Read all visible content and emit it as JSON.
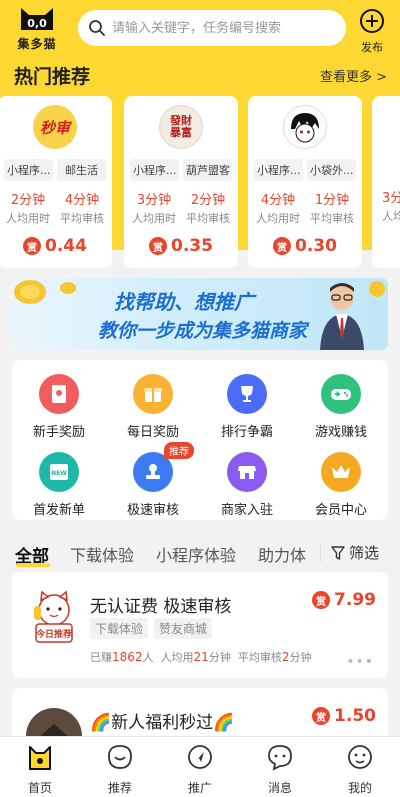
{
  "header": {
    "logo_text": "集多猫",
    "search_placeholder": "请输入关键字，任务编号搜索",
    "publish_label": "发布"
  },
  "hot": {
    "title": "热门推荐",
    "see_more": "查看更多 >",
    "cards": [
      {
        "avatar_text": "秒审",
        "tags": [
          "小程序...",
          "邮生活"
        ],
        "avg_time": "2分钟",
        "avg_time_label": "人均用时",
        "avg_review": "4分钟",
        "avg_review_label": "平均审核",
        "reward_icon": "赏",
        "reward": "0.44"
      },
      {
        "avatar_text": "發財暴富",
        "tags": [
          "小程序...",
          "葫芦盟客"
        ],
        "avg_time": "3分钟",
        "avg_time_label": "人均用时",
        "avg_review": "2分钟",
        "avg_review_label": "平均审核",
        "reward_icon": "赏",
        "reward": "0.35"
      },
      {
        "avatar_text": "",
        "tags": [
          "小程序...",
          "小袋外..."
        ],
        "avg_time": "4分钟",
        "avg_time_label": "人均用时",
        "avg_review": "1分钟",
        "avg_review_label": "平均审核",
        "reward_icon": "赏",
        "reward": "0.30"
      },
      {
        "avatar_text": "",
        "tags": [
          "",
          ""
        ],
        "avg_time": "3分",
        "avg_time_label": "人均",
        "avg_review": "",
        "avg_review_label": "",
        "reward_icon": "",
        "reward": ""
      }
    ]
  },
  "banner": {
    "line1": "找帮助、想推广",
    "line2": "教你一步成为集多猫商家"
  },
  "menu": [
    {
      "label": "新手奖励",
      "icon": "red-envelope-icon",
      "color": "#f25c5c"
    },
    {
      "label": "每日奖励",
      "icon": "gift-icon",
      "color": "#f9b233"
    },
    {
      "label": "排行争霸",
      "icon": "trophy-icon",
      "color": "#4a6cf7"
    },
    {
      "label": "游戏赚钱",
      "icon": "gamepad-icon",
      "color": "#2ec27e"
    },
    {
      "label": "首发新单",
      "icon": "new-icon",
      "color": "#1fb8a8"
    },
    {
      "label": "极速审核",
      "icon": "stamp-icon",
      "color": "#3d7bf2",
      "badge": "推荐"
    },
    {
      "label": "商家入驻",
      "icon": "store-icon",
      "color": "#8a5cf0"
    },
    {
      "label": "会员中心",
      "icon": "crown-icon",
      "color": "#f7a823"
    }
  ],
  "tabs": {
    "items": [
      "全部",
      "下载体验",
      "小程序体验",
      "助力体"
    ],
    "filter": "筛选"
  },
  "tasks": [
    {
      "title": "无认证费  极速审核",
      "tags": [
        "下载体验",
        "赞友商城"
      ],
      "earned_label": "已赚",
      "earned": "1862",
      "earned_unit": "人",
      "avg_label": "人均用",
      "avg": "21",
      "avg_unit": "分钟",
      "review_label": "平均审核",
      "review": "2",
      "review_unit": "分钟",
      "reward_icon": "赏",
      "reward": "7.99",
      "thumb_text": "今日推荐"
    },
    {
      "title": "🌈新人福利秒过🌈",
      "reward_icon": "赏",
      "reward": "1.50"
    }
  ],
  "bottom_nav": [
    {
      "label": "首页",
      "icon": "home-cat-icon"
    },
    {
      "label": "推荐",
      "icon": "recommend-icon"
    },
    {
      "label": "推广",
      "icon": "promote-icon"
    },
    {
      "label": "消息",
      "icon": "message-icon"
    },
    {
      "label": "我的",
      "icon": "profile-icon"
    }
  ],
  "colors": {
    "brand_yellow": "#fdd832",
    "accent_red": "#e8452c"
  }
}
